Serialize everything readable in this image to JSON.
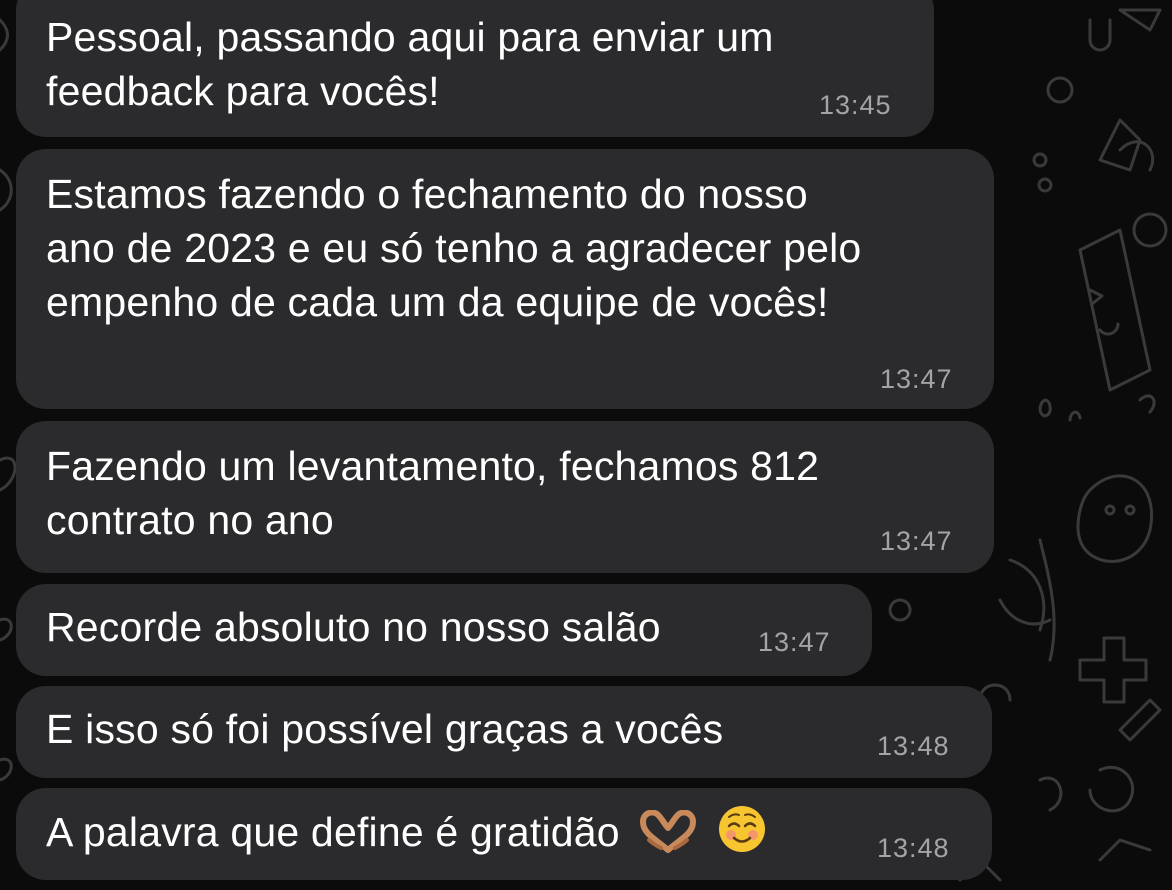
{
  "chat": {
    "messages": [
      {
        "text": "Pessoal, passando aqui para enviar um\nfeedback para vocês!",
        "time": "13:45"
      },
      {
        "text": "Estamos fazendo o fechamento do nosso\nano de 2023 e eu só tenho a agradecer pelo\nempenho de cada um da equipe de vocês!",
        "time": "13:47"
      },
      {
        "text": "Fazendo um levantamento, fechamos 812\ncontrato no ano",
        "time": "13:47"
      },
      {
        "text": "Recorde absoluto no nosso salão",
        "time": "13:47"
      },
      {
        "text": "E isso só foi possível graças a vocês",
        "time": "13:48"
      },
      {
        "text": "A palavra que define é gratidão",
        "time": "13:48",
        "emojis": [
          "heart-hands-emoji",
          "smiling-face-emoji"
        ]
      }
    ]
  },
  "colors": {
    "background": "#0b0b0b",
    "bubble": "#2b2b2d",
    "text": "#ffffff",
    "timestamp": "#a4a4a7"
  }
}
